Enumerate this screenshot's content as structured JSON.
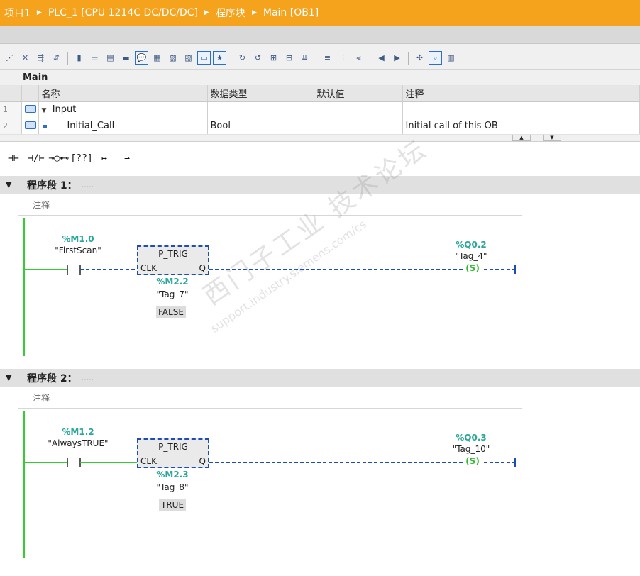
{
  "breadcrumb": {
    "items": [
      "项目1",
      "PLC_1 [CPU 1214C DC/DC/DC]",
      "程序块",
      "Main [OB1]"
    ]
  },
  "toolbar": {
    "icons": [
      "insert-row-icon",
      "delete-row-icon",
      "insert-network-icon",
      "delete-network-icon",
      "move-icon",
      "expand-all-icon",
      "collapse-all-icon",
      "absolute-address-icon",
      "comment-icon",
      "favorites-icon",
      "download-icon",
      "upload-icon",
      "symbol-icon",
      "monitor-icon",
      "compare-icon",
      "go-to-icon",
      "network-comment-icon",
      "single-step-icon",
      "jump-icon",
      "cross-ref-icon",
      "watch-on-icon",
      "monitor-value-icon",
      "db-icon"
    ]
  },
  "interface": {
    "title": "Main",
    "columns": [
      "名称",
      "数据类型",
      "默认值",
      "注释"
    ],
    "rows": [
      {
        "num": "1",
        "name": "Input",
        "type": "",
        "default": "",
        "comment": ""
      },
      {
        "num": "2",
        "name": "Initial_Call",
        "type": "Bool",
        "default": "",
        "comment": "Initial call of this OB"
      }
    ]
  },
  "lad_instructions": [
    "⊣⊢",
    "⊣/⊢",
    "⊸◯⊷",
    "[??]",
    "↦",
    "⇀"
  ],
  "networks": [
    {
      "title": "程序段 1：",
      "title_dots": ".....",
      "comment": "注释",
      "contact": {
        "addr": "%M1.0",
        "symbol": "\"FirstScan\""
      },
      "box": {
        "name": "P_TRIG",
        "in": "CLK",
        "out": "Q",
        "addr": "%M2.2",
        "symbol": "\"Tag_7\"",
        "state": "FALSE"
      },
      "coil": {
        "addr": "%Q0.2",
        "symbol": "\"Tag_4\"",
        "label": "S"
      }
    },
    {
      "title": "程序段 2：",
      "title_dots": ".....",
      "comment": "注释",
      "contact": {
        "addr": "%M1.2",
        "symbol": "\"AlwaysTRUE\""
      },
      "box": {
        "name": "P_TRIG",
        "in": "CLK",
        "out": "Q",
        "addr": "%M2.3",
        "symbol": "\"Tag_8\"",
        "state": "TRUE"
      },
      "coil": {
        "addr": "%Q0.3",
        "symbol": "\"Tag_10\"",
        "label": "S"
      }
    }
  ],
  "watermark": {
    "text": "西门子工业 技术论坛",
    "url": "support.industry.siemens.com/cs"
  },
  "colors": {
    "title_bar": "#f5a21c",
    "power_rail": "#33cc33",
    "dashed_wire": "#1c4db3",
    "address": "#2aa79a"
  }
}
